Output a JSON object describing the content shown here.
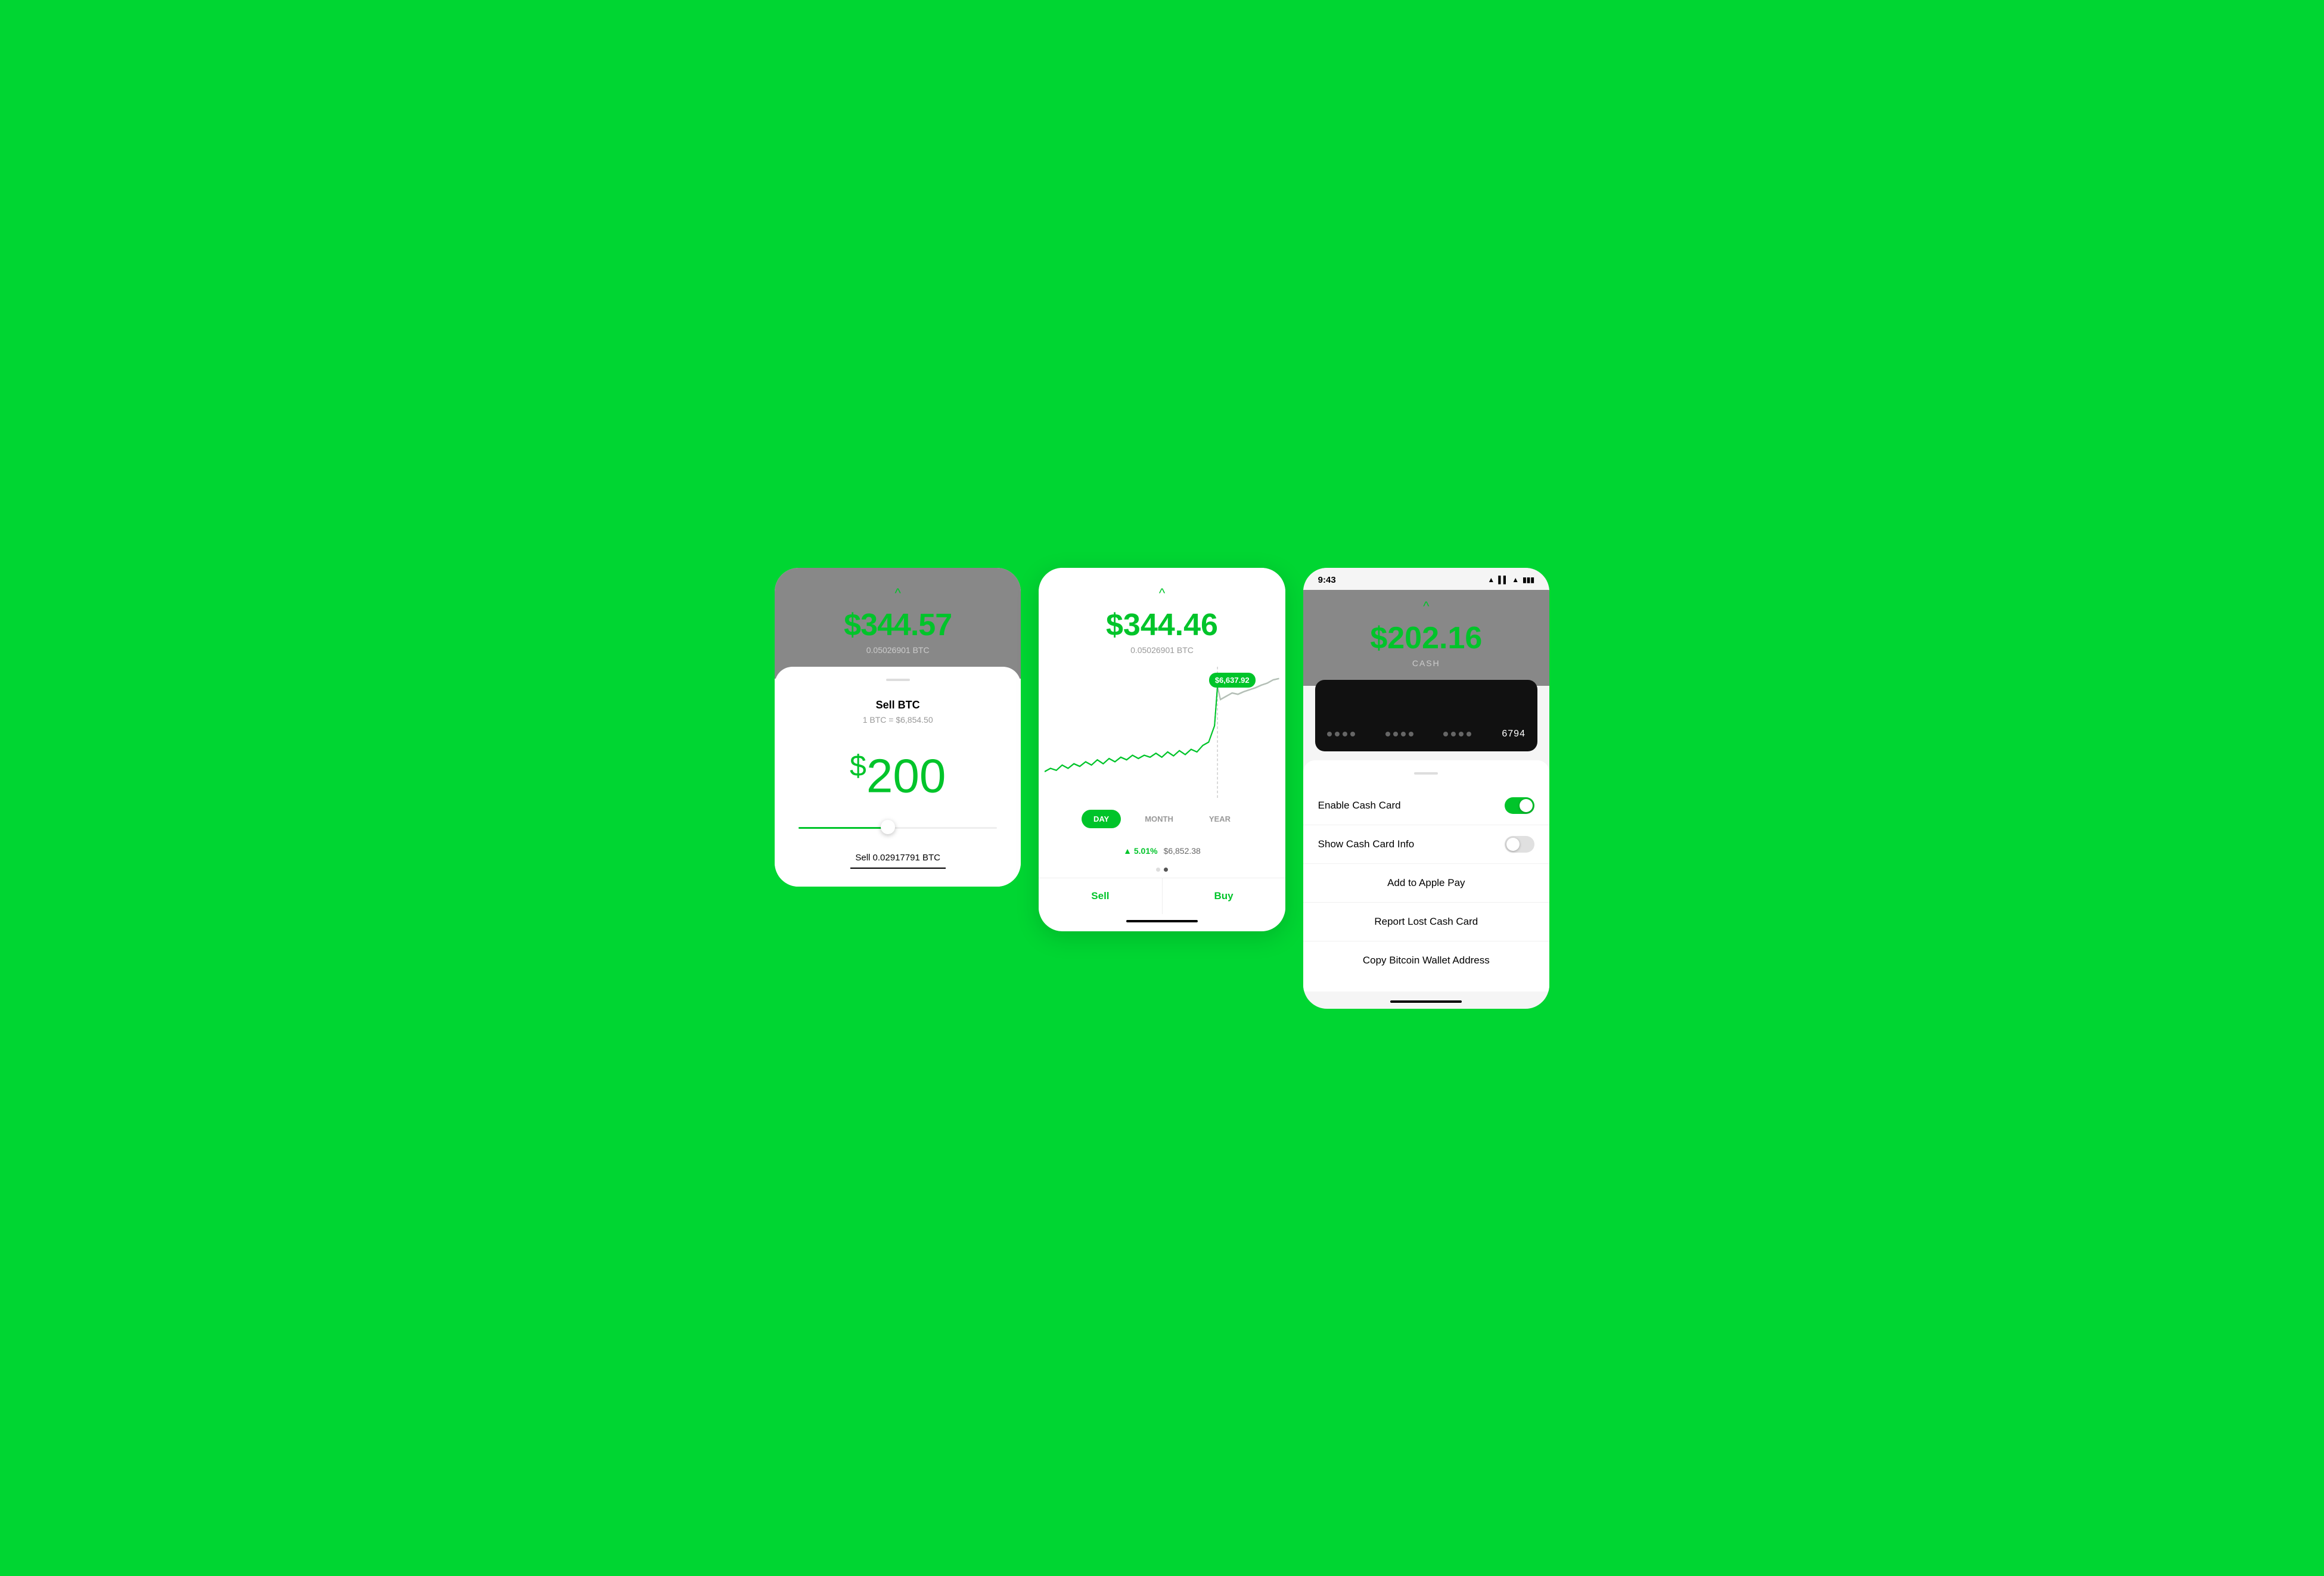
{
  "background_color": "#00D632",
  "screen1": {
    "btc_balance": "$344.57",
    "btc_amount": "0.05026901 BTC",
    "chevron": "^",
    "sell_title": "Sell BTC",
    "sell_subtitle": "1 BTC = $6,854.50",
    "dollar_amount": "$200",
    "sell_label": "Sell 0.02917791 BTC"
  },
  "screen2": {
    "btc_balance": "$344.46",
    "btc_amount": "0.05026901 BTC",
    "chevron": "^",
    "price_bubble": "$6,637.92",
    "time_tabs": [
      {
        "label": "DAY",
        "active": true
      },
      {
        "label": "MONTH",
        "active": false
      },
      {
        "label": "YEAR",
        "active": false
      }
    ],
    "stats_pct": "▲ 5.01%",
    "stats_price": "$6,852.38",
    "sell_btn": "Sell",
    "buy_btn": "Buy"
  },
  "screen3": {
    "status_bar": {
      "time": "9:43",
      "icons": "▲ ▌▌ ▲ ▮▮▮"
    },
    "cash_balance": "$202.16",
    "cash_label": "CASH",
    "chevron": "^",
    "card_number_end": "6794",
    "menu_items": [
      {
        "label": "Enable Cash Card",
        "type": "toggle",
        "value": "on"
      },
      {
        "label": "Show Cash Card Info",
        "type": "toggle",
        "value": "off"
      },
      {
        "label": "Add to Apple Pay",
        "type": "plain"
      },
      {
        "label": "Report Lost Cash Card",
        "type": "plain"
      },
      {
        "label": "Copy Bitcoin Wallet Address",
        "type": "plain"
      }
    ]
  }
}
